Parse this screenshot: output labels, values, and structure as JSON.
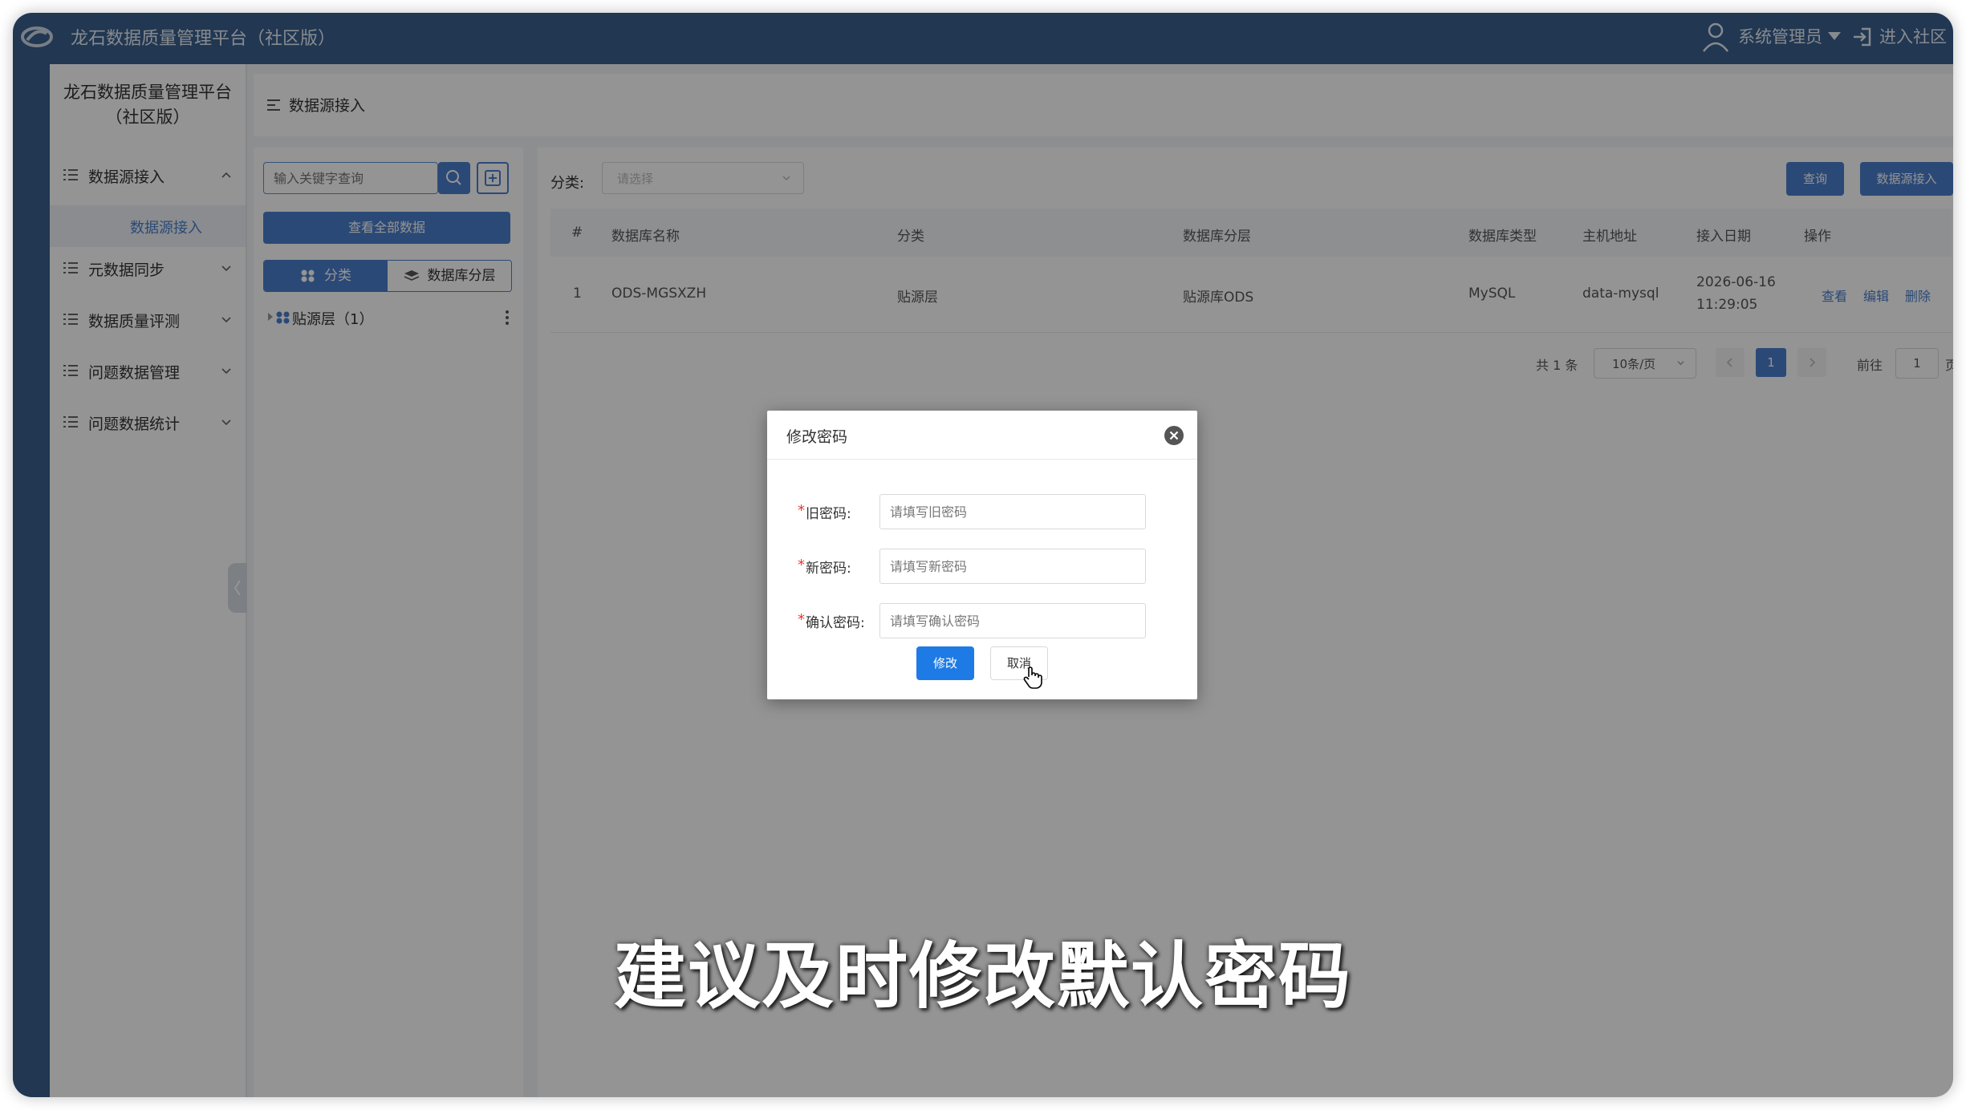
{
  "header": {
    "app_title": "龙石数据质量管理平台（社区版）",
    "user_name": "系统管理员",
    "community_link": "进入社区"
  },
  "sidebar": {
    "title_line1": "龙石数据质量管理平台",
    "title_line2": "（社区版）",
    "items": [
      {
        "label": "数据源接入"
      },
      {
        "label": "元数据同步"
      },
      {
        "label": "数据质量评测"
      },
      {
        "label": "问题数据管理"
      },
      {
        "label": "问题数据统计"
      }
    ],
    "active_sub": "数据源接入"
  },
  "breadcrumb": {
    "label": "数据源接入"
  },
  "left_panel": {
    "search_placeholder": "输入关键字查询",
    "view_all_label": "查看全部数据",
    "tab_category": "分类",
    "tab_layer": "数据库分层",
    "tree_node": "贴源层（1）"
  },
  "main": {
    "filter_label": "分类:",
    "filter_placeholder": "请选择",
    "query_label": "查询",
    "ingest_label": "数据源接入",
    "columns": [
      "#",
      "数据库名称",
      "分类",
      "数据库分层",
      "数据库类型",
      "主机地址",
      "接入日期",
      "操作"
    ],
    "rows": [
      {
        "index": "1",
        "db_name": "ODS-MGSXZH",
        "category": "贴源层",
        "layer": "贴源库ODS",
        "db_type": "MySQL",
        "host": "data-mysql",
        "date_line1": "2026-06-16",
        "date_line2": "11:29:05",
        "actions": [
          "查看",
          "编辑",
          "删除"
        ]
      }
    ],
    "pager": {
      "total": "共 1 条",
      "page_size": "10条/页",
      "current": "1",
      "goto_label": "前往",
      "goto_value": "1",
      "page_suffix": "页"
    }
  },
  "dialog": {
    "title": "修改密码",
    "fields": [
      {
        "label": "旧密码:",
        "placeholder": "请填写旧密码"
      },
      {
        "label": "新密码:",
        "placeholder": "请填写新密码"
      },
      {
        "label": "确认密码:",
        "placeholder": "请填写确认密码"
      }
    ],
    "submit_label": "修改",
    "cancel_label": "取消"
  },
  "subtitle": "建议及时修改默认密码",
  "colors": {
    "header_bg": "#3a5f8e",
    "primary": "#4a7fcb",
    "dialog_primary": "#1e7be6",
    "required": "#e53935"
  }
}
